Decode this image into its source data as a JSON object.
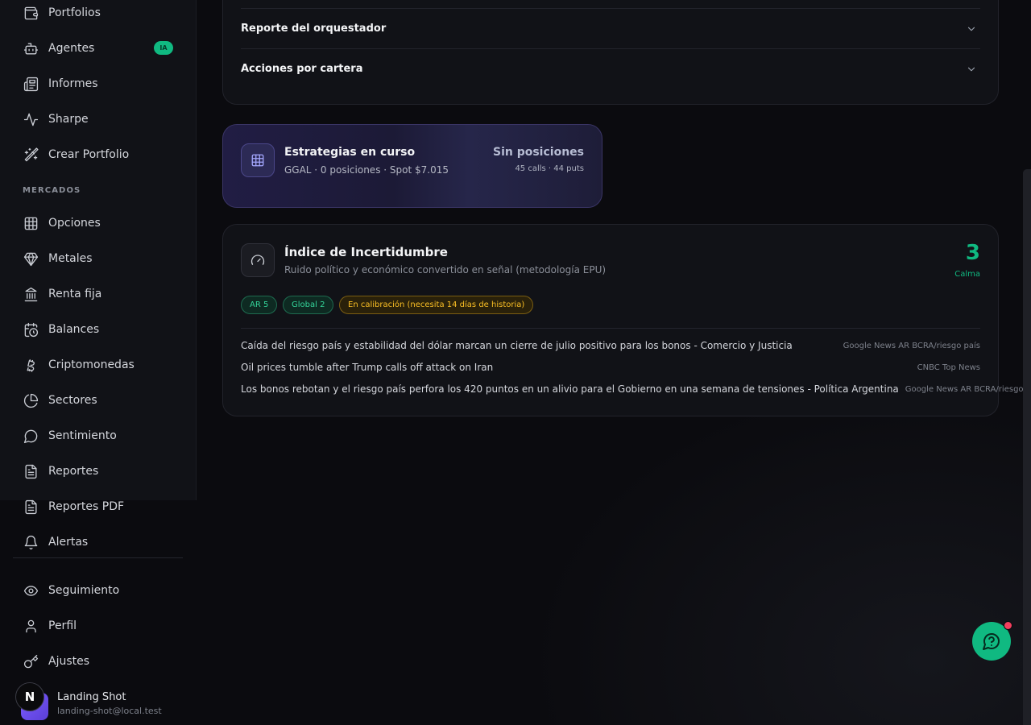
{
  "sidebar": {
    "items_top": [
      {
        "label": "Portfolios",
        "icon": "wallet-icon"
      },
      {
        "label": "Agentes",
        "icon": "bot-icon",
        "badge": "IA"
      },
      {
        "label": "Informes",
        "icon": "newspaper-icon"
      },
      {
        "label": "Sharpe",
        "icon": "activity-icon"
      },
      {
        "label": "Crear Portfolio",
        "icon": "magic-wand-icon"
      }
    ],
    "section_markets": "MERCADOS",
    "items_markets": [
      {
        "label": "Opciones",
        "icon": "grid-icon"
      },
      {
        "label": "Metales",
        "icon": "gem-icon"
      },
      {
        "label": "Renta fija",
        "icon": "bank-icon"
      },
      {
        "label": "Balances",
        "icon": "calendar-clock-icon"
      },
      {
        "label": "Criptomonedas",
        "icon": "bitcoin-icon"
      },
      {
        "label": "Sectores",
        "icon": "pie-chart-icon"
      },
      {
        "label": "Sentimiento",
        "icon": "message-circle-icon"
      },
      {
        "label": "Reportes",
        "icon": "file-text-icon"
      },
      {
        "label": "Reportes PDF",
        "icon": "file-pdf-icon"
      },
      {
        "label": "Alertas",
        "icon": "bell-icon"
      }
    ],
    "items_bottom": [
      {
        "label": "Seguimiento",
        "icon": "eye-icon"
      },
      {
        "label": "Perfil",
        "icon": "user-icon"
      },
      {
        "label": "Ajustes",
        "icon": "key-icon"
      }
    ],
    "user": {
      "initial": "N",
      "name": "Landing Shot",
      "email": "landing-shot@local.test"
    }
  },
  "top_card": {
    "rows": [
      {
        "label": "Reporte del orquestador"
      },
      {
        "label": "Acciones por cartera"
      }
    ]
  },
  "strategies": {
    "title": "Estrategias en curso",
    "subtitle": "GGAL · 0 posiciones · Spot $7.015",
    "status": "Sin posiciones",
    "counts": "45 calls · 44 puts"
  },
  "uncertainty": {
    "title": "Índice de Incertidumbre",
    "subtitle": "Ruido político y económico convertido en señal (metodología EPU)",
    "value": "3",
    "value_label": "Calma",
    "pills": [
      {
        "label": "AR 5",
        "tone": "green"
      },
      {
        "label": "Global 2",
        "tone": "green"
      },
      {
        "label": "En calibración (necesita 14 días de historia)",
        "tone": "amber"
      }
    ],
    "news": [
      {
        "headline": "Caída del riesgo país y estabilidad del dólar marcan un cierre de julio positivo para los bonos - Comercio y Justicia",
        "source": "Google News AR BCRA/riesgo país"
      },
      {
        "headline": "Oil prices tumble after Trump calls off attack on Iran",
        "source": "CNBC Top News"
      },
      {
        "headline": "Los bonos rebotan y el riesgo país perfora los 420 puntos en un alivio para el Gobierno en una semana de tensiones - Política Argentina",
        "source": "Google News AR BCRA/riesgo país"
      }
    ]
  },
  "colors": {
    "accent": "#10b981",
    "warning": "#fbbf24",
    "notification": "#f43f5e"
  }
}
